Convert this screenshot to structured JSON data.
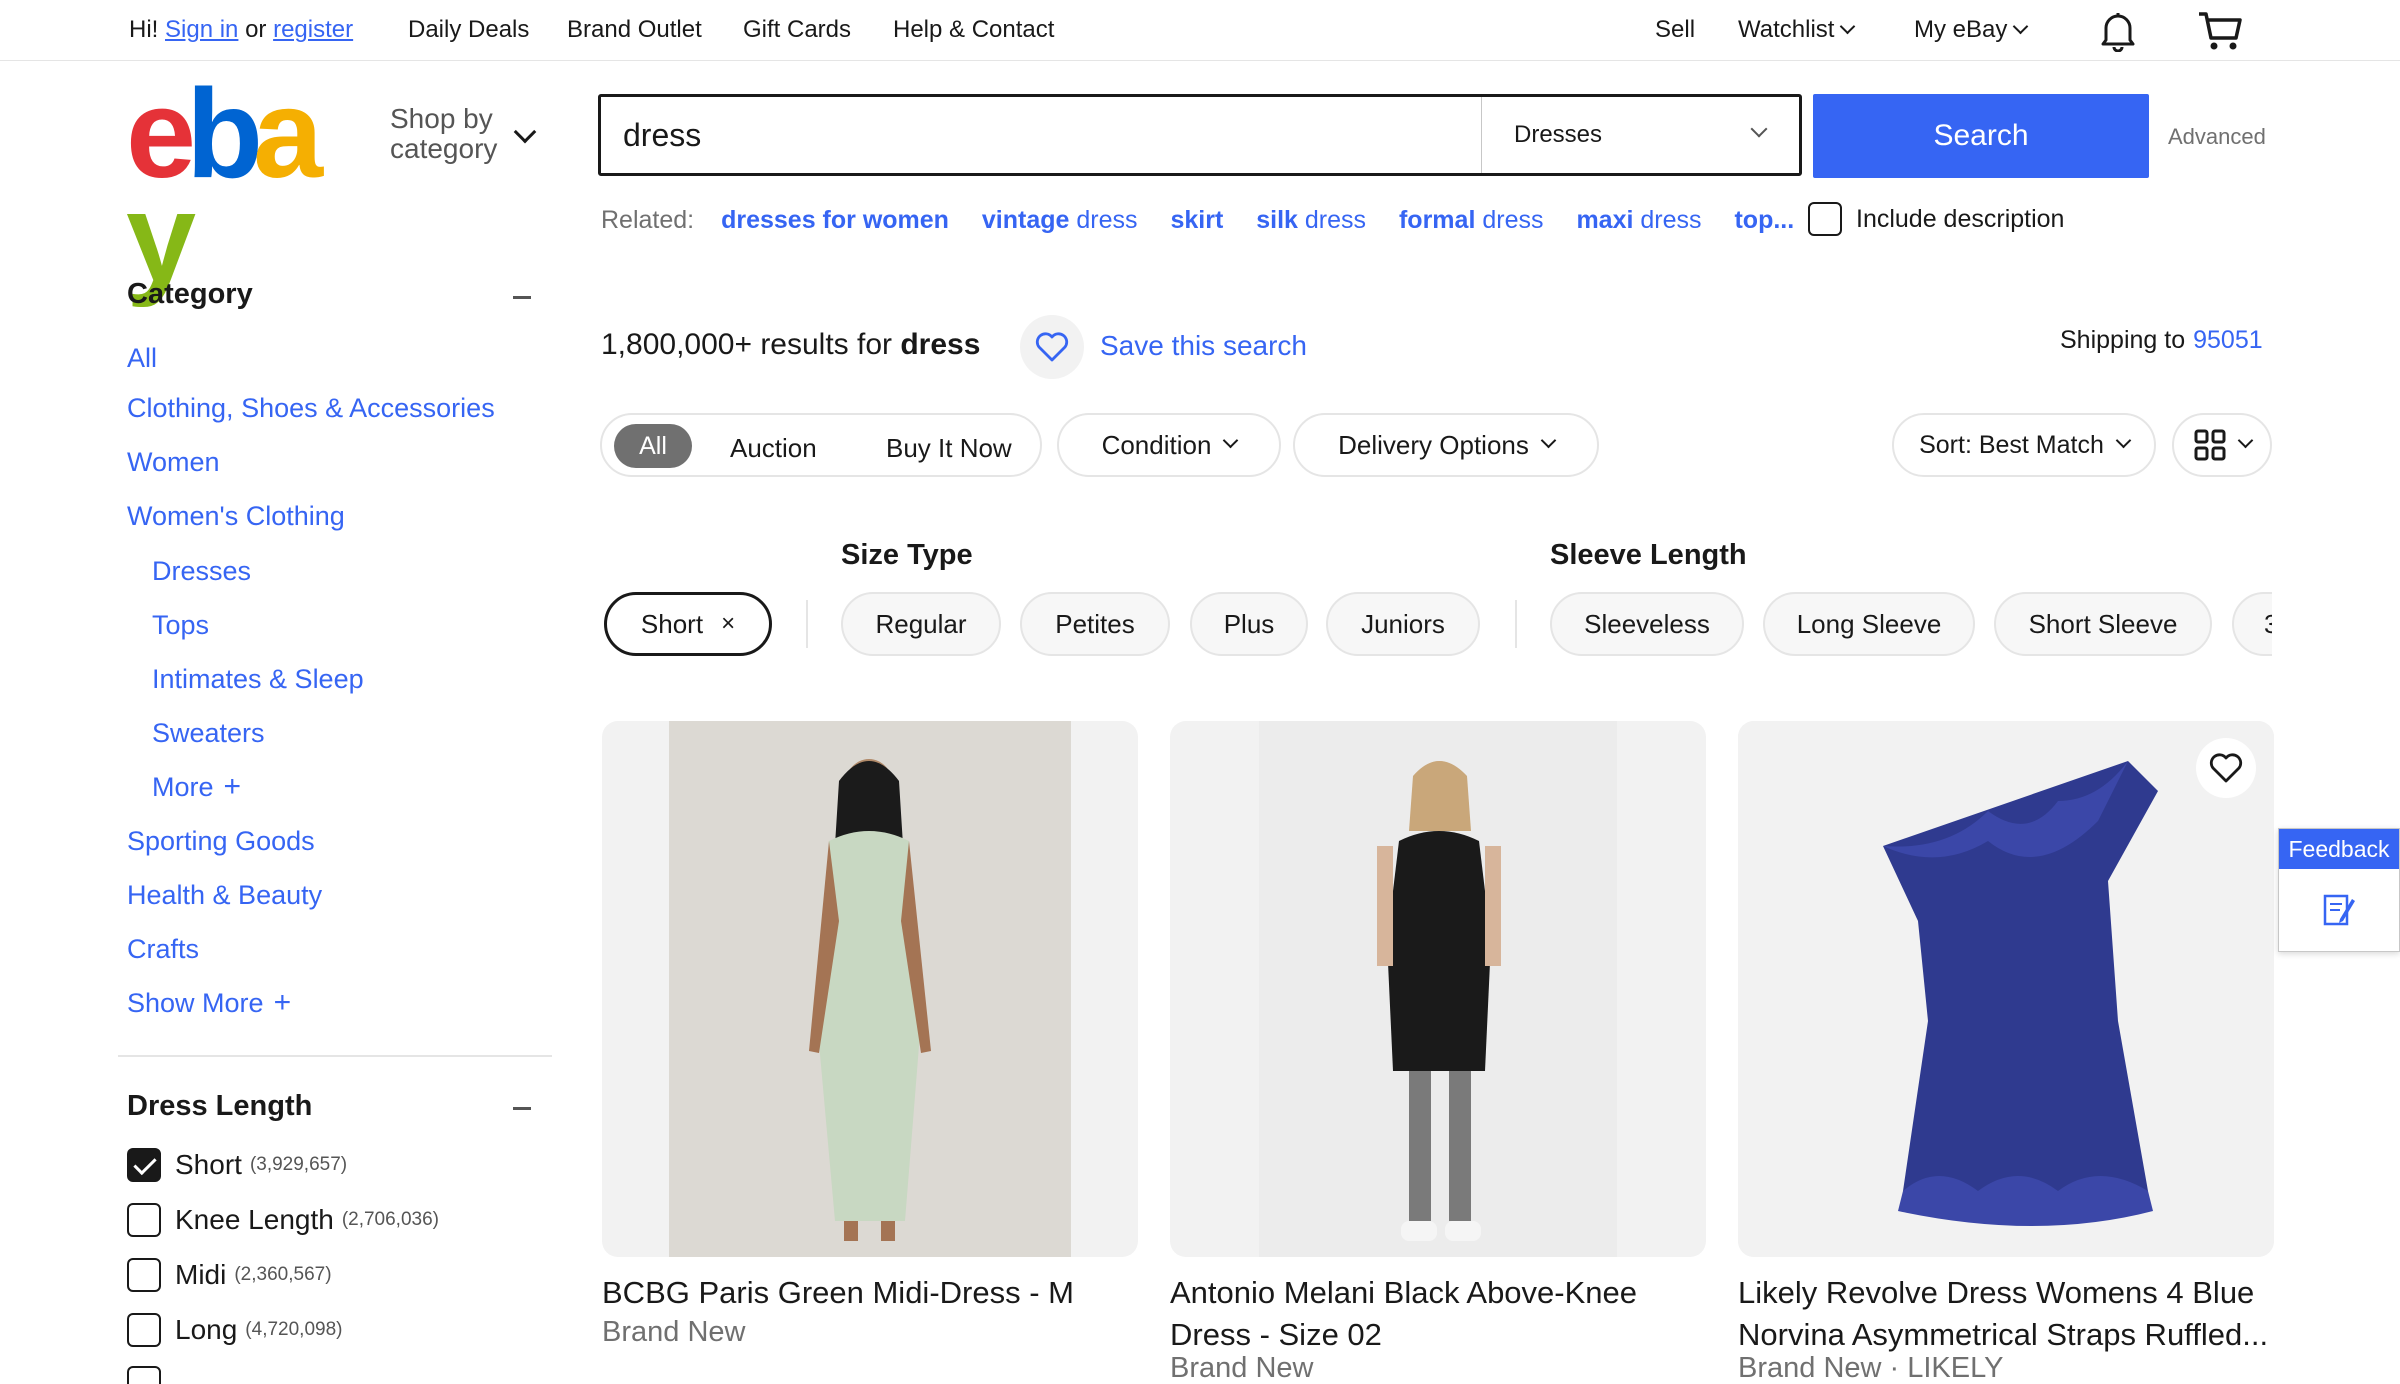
{
  "topbar": {
    "greeting": "Hi!",
    "sign_in": "Sign in",
    "or": "or",
    "register": "register",
    "links": [
      "Daily Deals",
      "Brand Outlet",
      "Gift Cards",
      "Help & Contact"
    ],
    "sell": "Sell",
    "watchlist": "Watchlist",
    "my_ebay": "My eBay",
    "icons": [
      "bell-icon",
      "cart-icon"
    ]
  },
  "header": {
    "logo_letters": [
      "e",
      "b",
      "a",
      "y"
    ],
    "logo_colors": [
      "#e53238",
      "#0064d2",
      "#f5af02",
      "#86b817"
    ],
    "shop_by_line1": "Shop by",
    "shop_by_line2": "category",
    "search_value": "dress",
    "category_select": "Dresses",
    "search_button": "Search",
    "advanced": "Advanced",
    "accent_color": "#3665f3"
  },
  "related": {
    "label": "Related:",
    "items": [
      {
        "bold": "dresses for women",
        "rest": ""
      },
      {
        "bold": "vintage",
        "rest": " dress"
      },
      {
        "bold": "skirt",
        "rest": ""
      },
      {
        "bold": "silk",
        "rest": " dress"
      },
      {
        "bold": "formal",
        "rest": " dress"
      },
      {
        "bold": "maxi",
        "rest": " dress"
      },
      {
        "bold": "top...",
        "rest": ""
      }
    ],
    "include_description": "Include description"
  },
  "sidebar": {
    "category_heading": "Category",
    "categories": [
      {
        "label": "All",
        "indent": false
      },
      {
        "label": "Clothing, Shoes & Accessories",
        "indent": false
      },
      {
        "label": "Women",
        "indent": false
      },
      {
        "label": "Women's Clothing",
        "indent": false
      },
      {
        "label": "Dresses",
        "indent": true
      },
      {
        "label": "Tops",
        "indent": true
      },
      {
        "label": "Intimates & Sleep",
        "indent": true
      },
      {
        "label": "Sweaters",
        "indent": true
      },
      {
        "label": "More",
        "indent": true
      },
      {
        "label": "Sporting Goods",
        "indent": false
      },
      {
        "label": "Health & Beauty",
        "indent": false
      },
      {
        "label": "Crafts",
        "indent": false
      },
      {
        "label": "Show More",
        "indent": false
      }
    ],
    "dress_length_heading": "Dress Length",
    "dress_lengths": [
      {
        "label": "Short",
        "count": "(3,929,657)",
        "checked": true
      },
      {
        "label": "Knee Length",
        "count": "(2,706,036)",
        "checked": false
      },
      {
        "label": "Midi",
        "count": "(2,360,567)",
        "checked": false
      },
      {
        "label": "Long",
        "count": "(4,720,098)",
        "checked": false
      }
    ]
  },
  "results": {
    "count": "1,800,000+",
    "results_for": " results for ",
    "query": "dress",
    "save_search": "Save this search",
    "shipping_to": "Shipping to",
    "zip": "95051"
  },
  "filters": {
    "buying_format": [
      "All",
      "Auction",
      "Buy It Now"
    ],
    "condition": "Condition",
    "delivery": "Delivery Options",
    "sort": "Sort: Best Match"
  },
  "chips": {
    "size_type_label": "Size Type",
    "sleeve_length_label": "Sleeve Length",
    "selected": "Short",
    "size_types": [
      "Regular",
      "Petites",
      "Plus",
      "Juniors"
    ],
    "sleeve_lengths": [
      "Sleeveless",
      "Long Sleeve",
      "Short Sleeve",
      "3"
    ]
  },
  "products": [
    {
      "title": "BCBG Paris Green Midi-Dress - M",
      "condition": "Brand New"
    },
    {
      "title": "Antonio Melani Black Above-Knee Dress - Size 02",
      "condition": "Brand New"
    },
    {
      "title": "Likely Revolve Dress Womens 4 Blue Norvina Asymmetrical Straps Ruffled...",
      "condition": "Brand New · LIKELY"
    }
  ],
  "feedback": {
    "label": "Feedback"
  }
}
